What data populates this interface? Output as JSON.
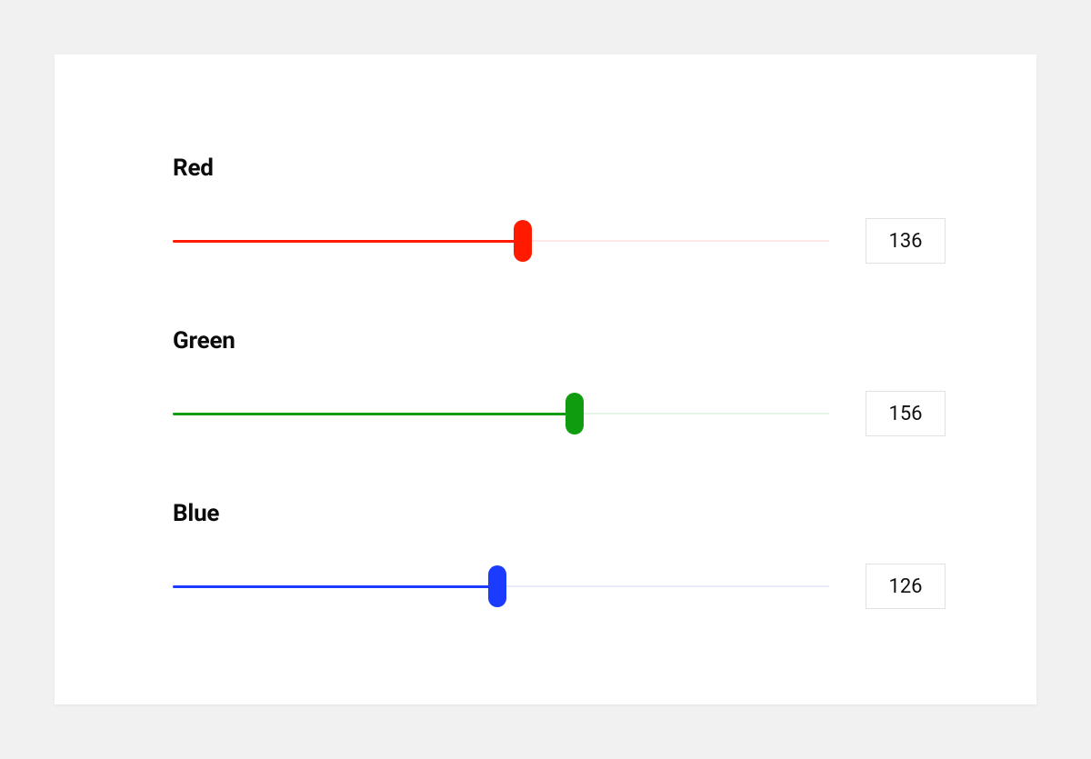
{
  "sliders": {
    "max": 255,
    "red": {
      "label": "Red",
      "value": 136,
      "fillColor": "#ff1a00",
      "trackColor": "#fde9e7",
      "thumbColor": "#ff1a00"
    },
    "green": {
      "label": "Green",
      "value": 156,
      "fillColor": "#0f9d0f",
      "trackColor": "#e6f4e7",
      "thumbColor": "#0f9d0f"
    },
    "blue": {
      "label": "Blue",
      "value": 126,
      "fillColor": "#1b3cff",
      "trackColor": "#e9ebfa",
      "thumbColor": "#1b3cff"
    }
  }
}
